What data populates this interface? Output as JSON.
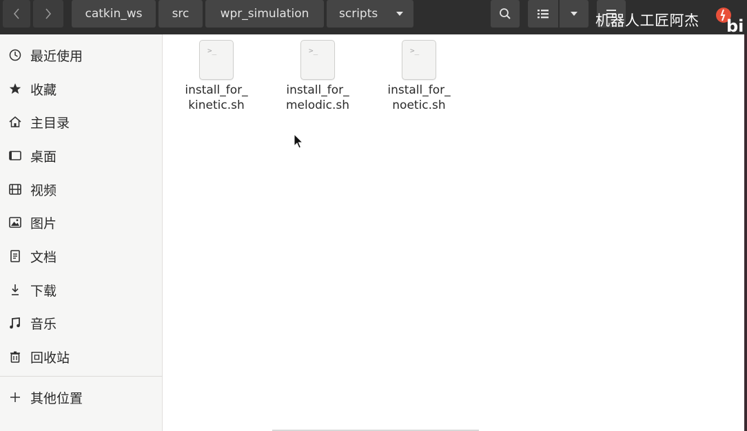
{
  "header": {
    "breadcrumbs": [
      "catkin_ws",
      "src",
      "wpr_simulation",
      "scripts"
    ],
    "watermark": "机器人工匠阿杰"
  },
  "sidebar": {
    "items": [
      {
        "label": "最近使用",
        "icon": "recent-icon"
      },
      {
        "label": "收藏",
        "icon": "star-icon"
      },
      {
        "label": "主目录",
        "icon": "home-icon"
      },
      {
        "label": "桌面",
        "icon": "desktop-icon"
      },
      {
        "label": "视频",
        "icon": "video-icon"
      },
      {
        "label": "图片",
        "icon": "picture-icon"
      },
      {
        "label": "文档",
        "icon": "document-icon"
      },
      {
        "label": "下载",
        "icon": "download-icon"
      },
      {
        "label": "音乐",
        "icon": "music-icon"
      },
      {
        "label": "回收站",
        "icon": "trash-icon"
      }
    ],
    "other_locations": {
      "label": "其他位置",
      "icon": "plus-icon"
    }
  },
  "files": [
    {
      "name": "install_for_\nkinetic.sh",
      "icon": "shell-script-icon",
      "prompt": ">_"
    },
    {
      "name": "install_for_\nmelodic.sh",
      "icon": "shell-script-icon",
      "prompt": ">_"
    },
    {
      "name": "install_for_\nnoetic.sh",
      "icon": "shell-script-icon",
      "prompt": ">_"
    }
  ],
  "colors": {
    "headerbar": "#2e2e2e",
    "button": "#454545",
    "sidebar": "#f6f6f5",
    "content": "#ffffff"
  }
}
